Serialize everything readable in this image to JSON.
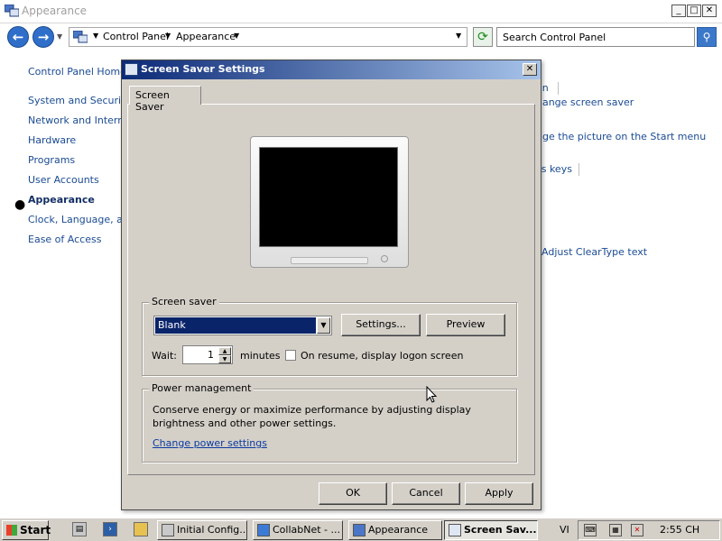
{
  "window": {
    "title": "Appearance",
    "minimize": "_",
    "maximize": "□",
    "close": "✕"
  },
  "nav": {
    "back": "←",
    "forward": "→",
    "breadcrumb": [
      "Control Panel",
      "Appearance"
    ],
    "search_placeholder": "Search Control Panel"
  },
  "sidebar": {
    "items": [
      {
        "label": "Control Panel Home"
      },
      {
        "label": "System and Security"
      },
      {
        "label": "Network and Interne"
      },
      {
        "label": "Hardware"
      },
      {
        "label": "Programs"
      },
      {
        "label": "User Accounts"
      },
      {
        "label": "Appearance",
        "active": true
      },
      {
        "label": "Clock, Language, and"
      },
      {
        "label": "Ease of Access"
      }
    ]
  },
  "right_links": [
    "on",
    "hange screen saver",
    "nge the picture on the Start menu",
    "ss keys",
    "s",
    "Adjust ClearType text"
  ],
  "dialog": {
    "title": "Screen Saver Settings",
    "close": "✕",
    "tab": "Screen Saver",
    "screen_saver_group": "Screen saver",
    "selected_saver": "Blank",
    "settings_button": "Settings...",
    "preview_button": "Preview",
    "wait_label": "Wait:",
    "wait_value": "1",
    "minutes_label": "minutes",
    "resume_checkbox_label": "On resume, display logon screen",
    "resume_checked": false,
    "power_group": "Power management",
    "power_text": "Conserve energy or maximize performance by adjusting display brightness and other power settings.",
    "power_link": "Change power settings",
    "ok": "OK",
    "cancel": "Cancel",
    "apply": "Apply"
  },
  "taskbar": {
    "start": "Start",
    "buttons": [
      {
        "label": "Initial Config..."
      },
      {
        "label": "CollabNet - ..."
      },
      {
        "label": "Appearance"
      },
      {
        "label": "Screen Sav...",
        "active": true
      }
    ],
    "language": "VI",
    "clock": "2:55 CH"
  },
  "colors": {
    "dialog_title_start": "#0c2a76",
    "dialog_title_end": "#a6c3ea",
    "link": "#1a4b93",
    "selection": "#0a246a"
  }
}
